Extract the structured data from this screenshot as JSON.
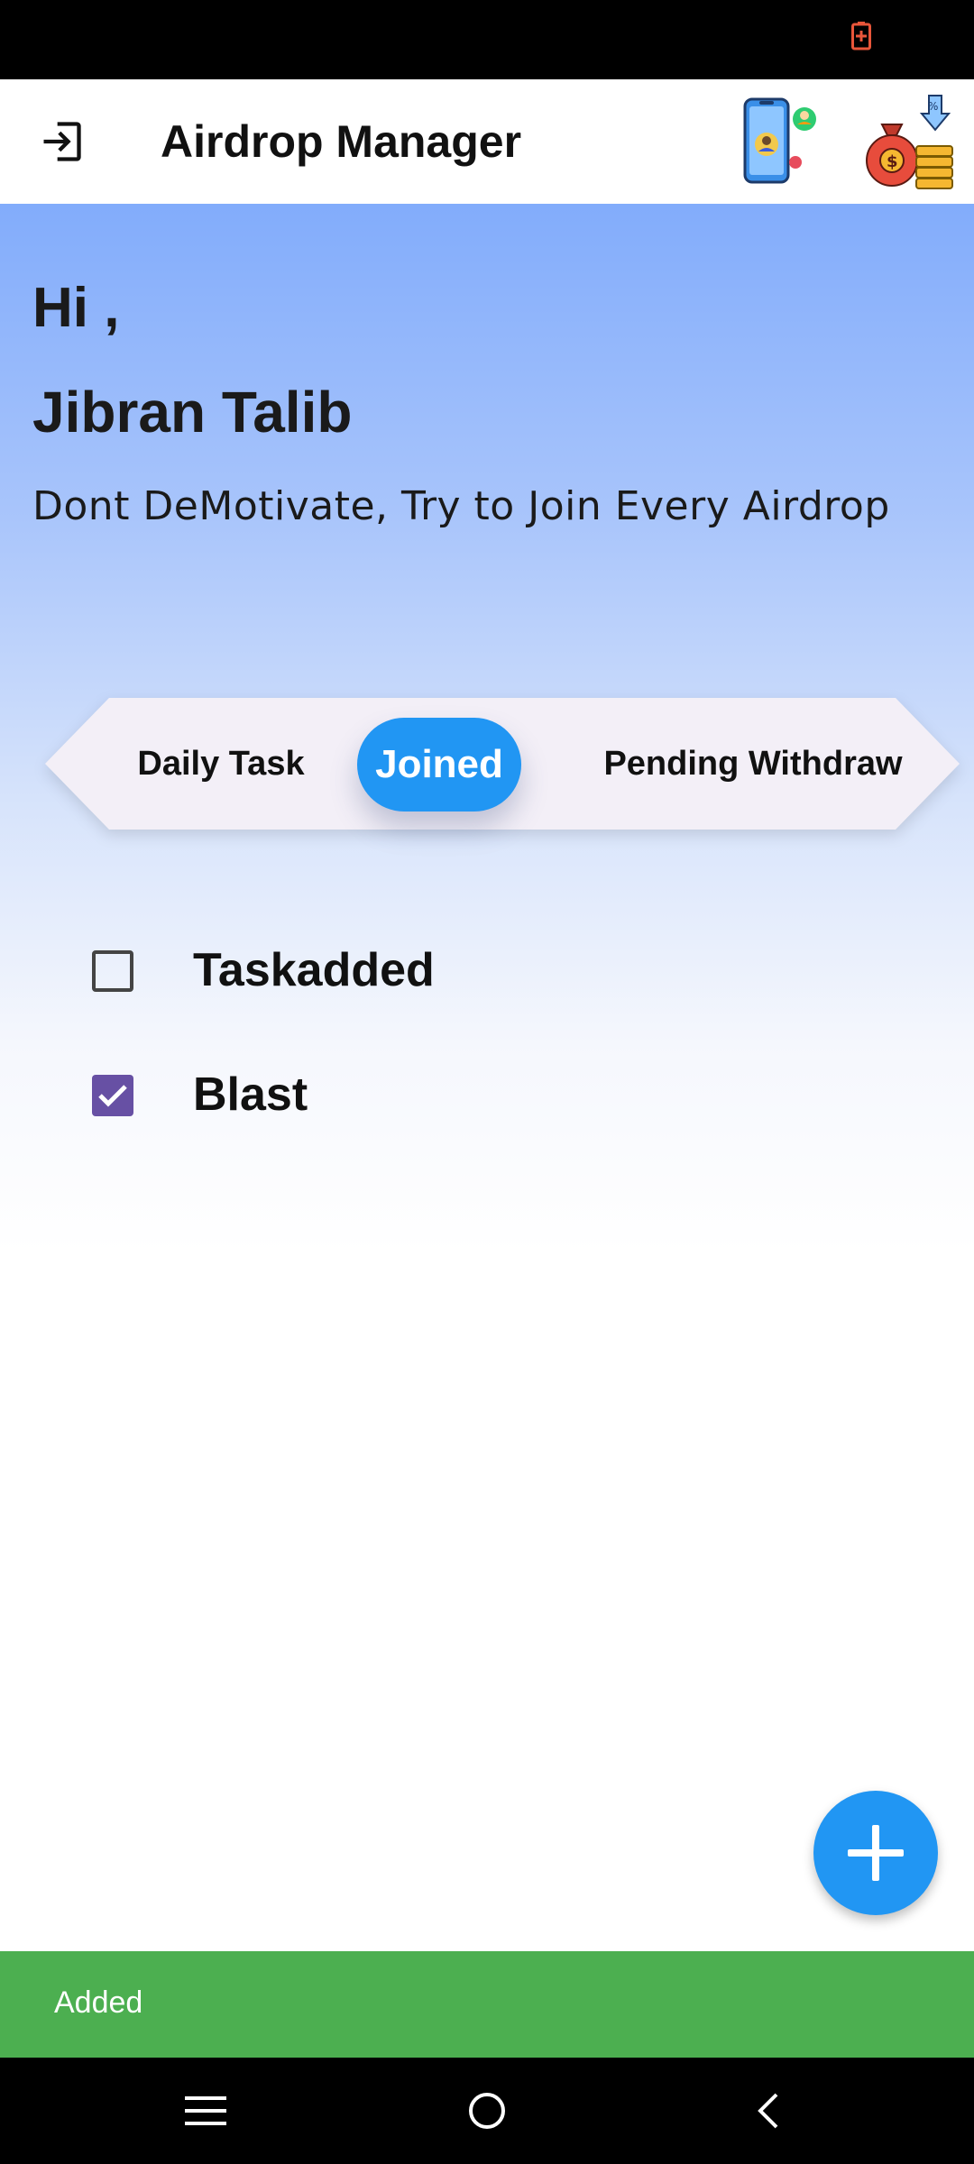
{
  "app_bar": {
    "title": "Airdrop Manager",
    "logout_icon": "logout-icon",
    "phone_icon": "phone-user-icon",
    "money_icon": "money-bag-icon"
  },
  "header": {
    "greeting": "Hi ,",
    "user_name": "Jibran Talib",
    "motivation": "Dont DeMotivate, Try to Join Every Airdrop"
  },
  "tabs": {
    "items": [
      "Daily Task",
      "Joined",
      "Pending Withdraw"
    ],
    "selected": "Joined"
  },
  "tasks": [
    {
      "label": "Taskadded",
      "checked": false
    },
    {
      "label": "Blast",
      "checked": true
    }
  ],
  "fab": {
    "icon": "plus-icon"
  },
  "snackbar": {
    "text": "Added"
  },
  "colors": {
    "accent": "#2196f3",
    "checkbox_checked": "#6750a4",
    "snackbar": "#4caf50",
    "gradient_top": "#82acfb"
  }
}
